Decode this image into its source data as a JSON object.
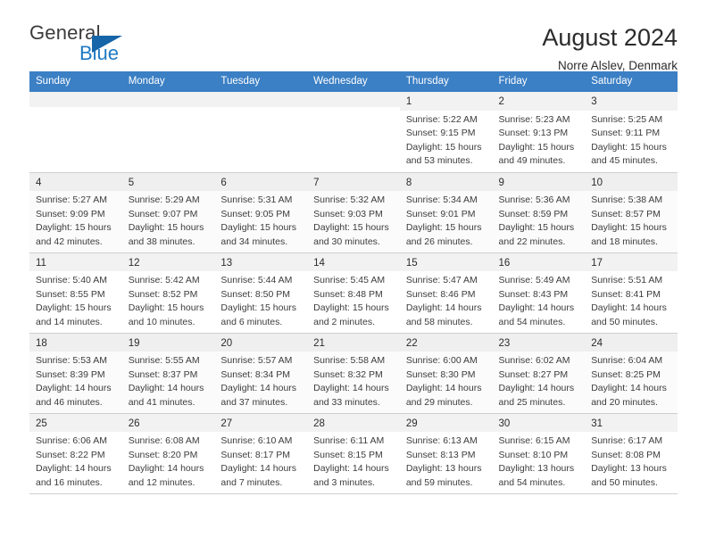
{
  "brand": {
    "name_part1": "General",
    "name_part2": "Blue",
    "flag_icon": "triangle-flag-icon",
    "accent_color": "#1f7ac4"
  },
  "header": {
    "title": "August 2024",
    "subtitle": "Norre Alslev, Denmark"
  },
  "calendar": {
    "header_bg": "#3b7fc4",
    "weekdays": [
      "Sunday",
      "Monday",
      "Tuesday",
      "Wednesday",
      "Thursday",
      "Friday",
      "Saturday"
    ],
    "labels": {
      "sunrise": "Sunrise:",
      "sunset": "Sunset:",
      "daylight": "Daylight:"
    },
    "weeks": [
      [
        {
          "day": ""
        },
        {
          "day": ""
        },
        {
          "day": ""
        },
        {
          "day": ""
        },
        {
          "day": "1",
          "sunrise": "Sunrise: 5:22 AM",
          "sunset": "Sunset: 9:15 PM",
          "daylight1": "Daylight: 15 hours",
          "daylight2": "and 53 minutes."
        },
        {
          "day": "2",
          "sunrise": "Sunrise: 5:23 AM",
          "sunset": "Sunset: 9:13 PM",
          "daylight1": "Daylight: 15 hours",
          "daylight2": "and 49 minutes."
        },
        {
          "day": "3",
          "sunrise": "Sunrise: 5:25 AM",
          "sunset": "Sunset: 9:11 PM",
          "daylight1": "Daylight: 15 hours",
          "daylight2": "and 45 minutes."
        }
      ],
      [
        {
          "day": "4",
          "sunrise": "Sunrise: 5:27 AM",
          "sunset": "Sunset: 9:09 PM",
          "daylight1": "Daylight: 15 hours",
          "daylight2": "and 42 minutes."
        },
        {
          "day": "5",
          "sunrise": "Sunrise: 5:29 AM",
          "sunset": "Sunset: 9:07 PM",
          "daylight1": "Daylight: 15 hours",
          "daylight2": "and 38 minutes."
        },
        {
          "day": "6",
          "sunrise": "Sunrise: 5:31 AM",
          "sunset": "Sunset: 9:05 PM",
          "daylight1": "Daylight: 15 hours",
          "daylight2": "and 34 minutes."
        },
        {
          "day": "7",
          "sunrise": "Sunrise: 5:32 AM",
          "sunset": "Sunset: 9:03 PM",
          "daylight1": "Daylight: 15 hours",
          "daylight2": "and 30 minutes."
        },
        {
          "day": "8",
          "sunrise": "Sunrise: 5:34 AM",
          "sunset": "Sunset: 9:01 PM",
          "daylight1": "Daylight: 15 hours",
          "daylight2": "and 26 minutes."
        },
        {
          "day": "9",
          "sunrise": "Sunrise: 5:36 AM",
          "sunset": "Sunset: 8:59 PM",
          "daylight1": "Daylight: 15 hours",
          "daylight2": "and 22 minutes."
        },
        {
          "day": "10",
          "sunrise": "Sunrise: 5:38 AM",
          "sunset": "Sunset: 8:57 PM",
          "daylight1": "Daylight: 15 hours",
          "daylight2": "and 18 minutes."
        }
      ],
      [
        {
          "day": "11",
          "sunrise": "Sunrise: 5:40 AM",
          "sunset": "Sunset: 8:55 PM",
          "daylight1": "Daylight: 15 hours",
          "daylight2": "and 14 minutes."
        },
        {
          "day": "12",
          "sunrise": "Sunrise: 5:42 AM",
          "sunset": "Sunset: 8:52 PM",
          "daylight1": "Daylight: 15 hours",
          "daylight2": "and 10 minutes."
        },
        {
          "day": "13",
          "sunrise": "Sunrise: 5:44 AM",
          "sunset": "Sunset: 8:50 PM",
          "daylight1": "Daylight: 15 hours",
          "daylight2": "and 6 minutes."
        },
        {
          "day": "14",
          "sunrise": "Sunrise: 5:45 AM",
          "sunset": "Sunset: 8:48 PM",
          "daylight1": "Daylight: 15 hours",
          "daylight2": "and 2 minutes."
        },
        {
          "day": "15",
          "sunrise": "Sunrise: 5:47 AM",
          "sunset": "Sunset: 8:46 PM",
          "daylight1": "Daylight: 14 hours",
          "daylight2": "and 58 minutes."
        },
        {
          "day": "16",
          "sunrise": "Sunrise: 5:49 AM",
          "sunset": "Sunset: 8:43 PM",
          "daylight1": "Daylight: 14 hours",
          "daylight2": "and 54 minutes."
        },
        {
          "day": "17",
          "sunrise": "Sunrise: 5:51 AM",
          "sunset": "Sunset: 8:41 PM",
          "daylight1": "Daylight: 14 hours",
          "daylight2": "and 50 minutes."
        }
      ],
      [
        {
          "day": "18",
          "sunrise": "Sunrise: 5:53 AM",
          "sunset": "Sunset: 8:39 PM",
          "daylight1": "Daylight: 14 hours",
          "daylight2": "and 46 minutes."
        },
        {
          "day": "19",
          "sunrise": "Sunrise: 5:55 AM",
          "sunset": "Sunset: 8:37 PM",
          "daylight1": "Daylight: 14 hours",
          "daylight2": "and 41 minutes."
        },
        {
          "day": "20",
          "sunrise": "Sunrise: 5:57 AM",
          "sunset": "Sunset: 8:34 PM",
          "daylight1": "Daylight: 14 hours",
          "daylight2": "and 37 minutes."
        },
        {
          "day": "21",
          "sunrise": "Sunrise: 5:58 AM",
          "sunset": "Sunset: 8:32 PM",
          "daylight1": "Daylight: 14 hours",
          "daylight2": "and 33 minutes."
        },
        {
          "day": "22",
          "sunrise": "Sunrise: 6:00 AM",
          "sunset": "Sunset: 8:30 PM",
          "daylight1": "Daylight: 14 hours",
          "daylight2": "and 29 minutes."
        },
        {
          "day": "23",
          "sunrise": "Sunrise: 6:02 AM",
          "sunset": "Sunset: 8:27 PM",
          "daylight1": "Daylight: 14 hours",
          "daylight2": "and 25 minutes."
        },
        {
          "day": "24",
          "sunrise": "Sunrise: 6:04 AM",
          "sunset": "Sunset: 8:25 PM",
          "daylight1": "Daylight: 14 hours",
          "daylight2": "and 20 minutes."
        }
      ],
      [
        {
          "day": "25",
          "sunrise": "Sunrise: 6:06 AM",
          "sunset": "Sunset: 8:22 PM",
          "daylight1": "Daylight: 14 hours",
          "daylight2": "and 16 minutes."
        },
        {
          "day": "26",
          "sunrise": "Sunrise: 6:08 AM",
          "sunset": "Sunset: 8:20 PM",
          "daylight1": "Daylight: 14 hours",
          "daylight2": "and 12 minutes."
        },
        {
          "day": "27",
          "sunrise": "Sunrise: 6:10 AM",
          "sunset": "Sunset: 8:17 PM",
          "daylight1": "Daylight: 14 hours",
          "daylight2": "and 7 minutes."
        },
        {
          "day": "28",
          "sunrise": "Sunrise: 6:11 AM",
          "sunset": "Sunset: 8:15 PM",
          "daylight1": "Daylight: 14 hours",
          "daylight2": "and 3 minutes."
        },
        {
          "day": "29",
          "sunrise": "Sunrise: 6:13 AM",
          "sunset": "Sunset: 8:13 PM",
          "daylight1": "Daylight: 13 hours",
          "daylight2": "and 59 minutes."
        },
        {
          "day": "30",
          "sunrise": "Sunrise: 6:15 AM",
          "sunset": "Sunset: 8:10 PM",
          "daylight1": "Daylight: 13 hours",
          "daylight2": "and 54 minutes."
        },
        {
          "day": "31",
          "sunrise": "Sunrise: 6:17 AM",
          "sunset": "Sunset: 8:08 PM",
          "daylight1": "Daylight: 13 hours",
          "daylight2": "and 50 minutes."
        }
      ]
    ]
  }
}
